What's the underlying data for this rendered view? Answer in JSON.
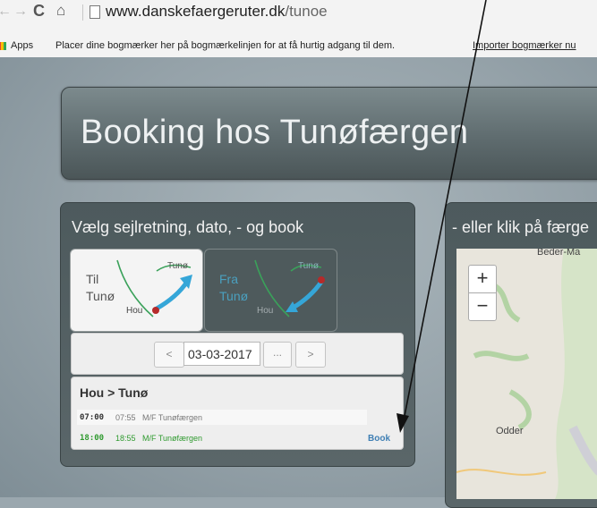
{
  "browser": {
    "url_host": "www.danskefaergeruter.dk",
    "url_path": "/tunoe",
    "apps_label": "Apps",
    "bookmarks_hint": "Placer dine bogmærker her på bogmærkelinjen for at få hurtig adgang til dem.",
    "import_link": "Importer bogmærker nu",
    "icons": [
      "back-icon",
      "forward-icon",
      "reload-icon",
      "home-icon",
      "page-icon",
      "apps-icon"
    ]
  },
  "header": {
    "title": "Booking hos Tunøfærgen"
  },
  "booking": {
    "heading": "Vælg sejlretning, dato, - og book",
    "tabs": [
      {
        "line1": "Til",
        "line2": "Tunø",
        "dest": "Tunø",
        "origin": "Hou"
      },
      {
        "line1": "Fra",
        "line2": "Tunø",
        "dest": "Tunø",
        "origin": "Hou"
      }
    ],
    "date": {
      "value": "03-03-2017",
      "prev_label": "<",
      "next_label": ">",
      "picker_label": "..."
    },
    "route_title": "Hou > Tunø",
    "departures": [
      {
        "dep": "07:00",
        "arr": "07:55",
        "ship": "M/F Tunøfærgen"
      },
      {
        "dep": "18:00",
        "arr": "18:55",
        "ship": "M/F Tunøfærgen"
      }
    ],
    "book_label": "Book"
  },
  "map": {
    "heading": "- eller klik på færge",
    "zoom_in": "+",
    "zoom_out": "−",
    "towns": [
      "Beder-Ma",
      "Odder"
    ]
  },
  "colors": {
    "panel": "#4d5a5d",
    "accent_blue": "#3f7fb4",
    "green": "#2f9a2f",
    "arrow_blue": "#2b9fd8"
  }
}
